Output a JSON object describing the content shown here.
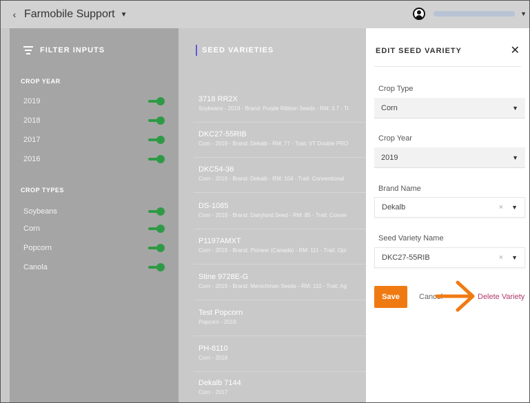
{
  "topbar": {
    "back_glyph": "‹",
    "title": "Farmobile Support",
    "caret": "▼",
    "user_caret": "▼"
  },
  "filters": {
    "title": "FILTER INPUTS",
    "crop_year_label": "CROP YEAR",
    "crop_years": [
      {
        "label": "2019",
        "on": true
      },
      {
        "label": "2018",
        "on": true
      },
      {
        "label": "2017",
        "on": true
      },
      {
        "label": "2016",
        "on": true
      }
    ],
    "crop_types_label": "CROP TYPES",
    "crop_types": [
      {
        "label": "Soybeans",
        "on": true
      },
      {
        "label": "Corn",
        "on": true
      },
      {
        "label": "Popcorn",
        "on": true
      },
      {
        "label": "Canola",
        "on": true
      }
    ]
  },
  "list": {
    "title": "SEED VARIETIES",
    "items": [
      {
        "name": "3718 RR2X",
        "detail": "Soybeans - 2019 - Brand: Purple Ribbon Seeds - RM: 3.7 - Tr"
      },
      {
        "name": "DKC27-55RIB",
        "detail": "Corn - 2019 - Brand: Dekalb - RM: 77 - Trait: VT Double PRO"
      },
      {
        "name": "DKC54-36",
        "detail": "Corn - 2019 - Brand: Dekalb - RM: 104 - Trait: Conventional"
      },
      {
        "name": "DS-1085",
        "detail": "Corn - 2019 - Brand: Dairyland Seed - RM: 85 - Trait: Conver"
      },
      {
        "name": "P1197AMXT",
        "detail": "Corn - 2019 - Brand: Pioneer (Canada) - RM: 111 - Trait: Opt"
      },
      {
        "name": "Stine 9728E-G",
        "detail": "Corn - 2019 - Brand: Merschman Seeds - RM: 110 - Trait: Ag"
      },
      {
        "name": "Test Popcorn",
        "detail": "Popcorn - 2019"
      },
      {
        "name": "PH-8110",
        "detail": "Corn - 2018"
      },
      {
        "name": "Dekalb 7144",
        "detail": "Corn - 2017"
      }
    ]
  },
  "panel": {
    "title": "EDIT SEED VARIETY",
    "close_glyph": "✕",
    "crop_type_label": "Crop Type",
    "crop_type_value": "Corn",
    "crop_year_label": "Crop Year",
    "crop_year_value": "2019",
    "brand_label": "Brand Name",
    "brand_value": "Dekalb",
    "variety_label": "Seed Variety Name",
    "variety_value": "DKC27-55RIB",
    "clear_glyph": "×",
    "dropdown_glyph": "▼",
    "save_label": "Save",
    "cancel_label": "Cancel",
    "delete_label": "Delete Variety"
  },
  "colors": {
    "toggle_on": "#2f9a46",
    "save_button": "#f07a12",
    "delete_link": "#b03a6a",
    "annotation_arrow": "#f07a12"
  }
}
